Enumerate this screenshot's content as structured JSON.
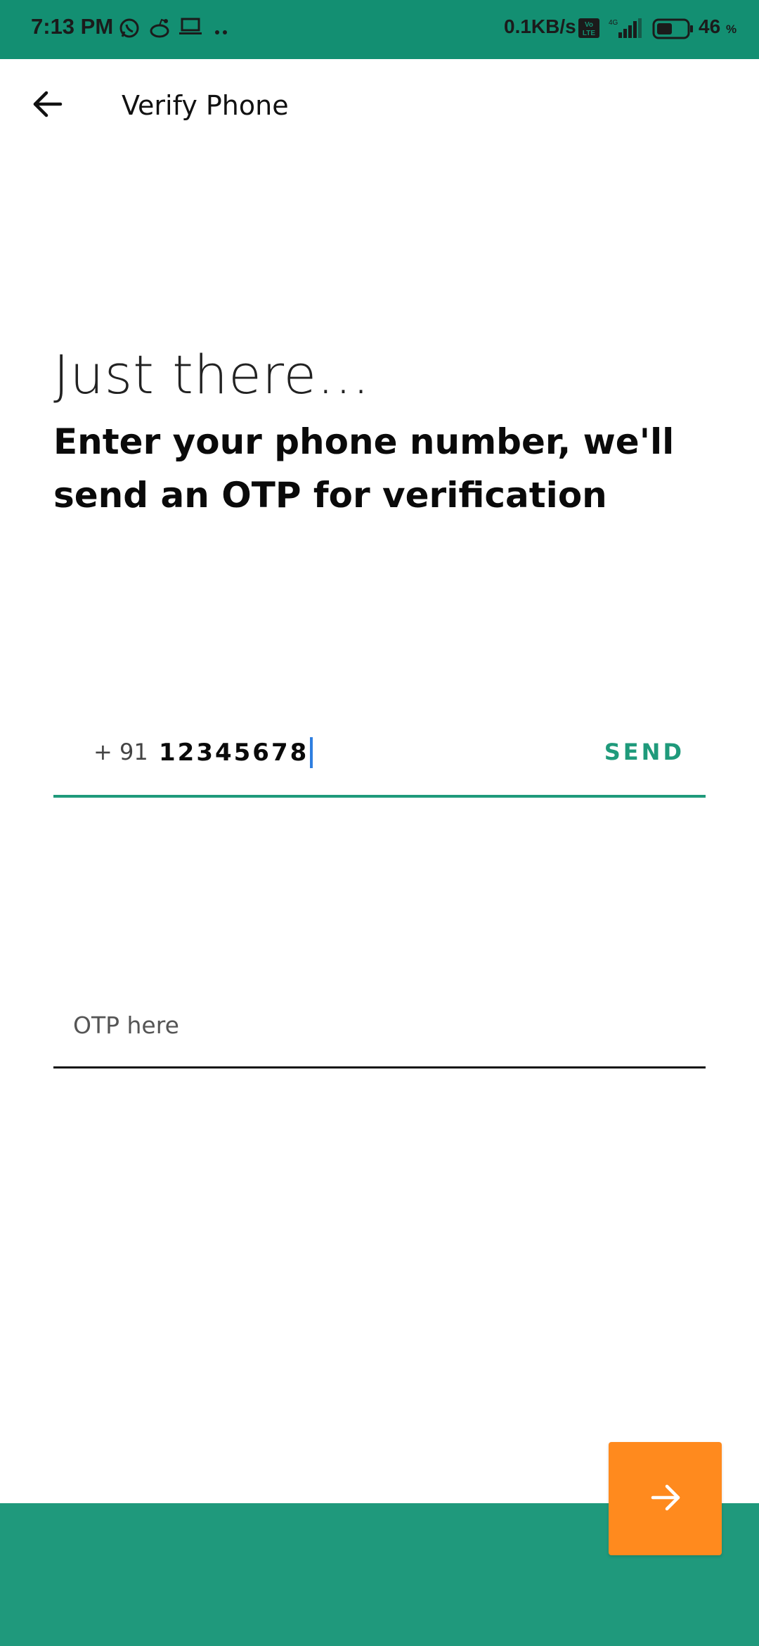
{
  "status_bar": {
    "time": "7:13 PM",
    "network_speed": "0.1KB/s",
    "battery_level": "46",
    "battery_unit": "%",
    "icons": [
      "whatsapp-icon",
      "reddit-icon",
      "laptop-icon",
      "more-dots-icon",
      "volte-icon",
      "signal-icon",
      "battery-icon"
    ],
    "volte_label": "Vo LTE",
    "network_type": "4G"
  },
  "app_bar": {
    "title": "Verify Phone",
    "back_icon": "arrow-left-icon"
  },
  "content": {
    "headline": "Just there...",
    "subheadline": "Enter your phone number, we'll send an OTP for verification"
  },
  "phone_field": {
    "country_code": "+ 91",
    "value": "12345678",
    "send_label": "SEND"
  },
  "otp_field": {
    "placeholder": "OTP here",
    "value": ""
  },
  "next_button": {
    "icon": "arrow-right-icon"
  },
  "colors": {
    "status_bar": "#138f72",
    "accent_green": "#1f9a7b",
    "next_button": "#ff8a1e"
  }
}
